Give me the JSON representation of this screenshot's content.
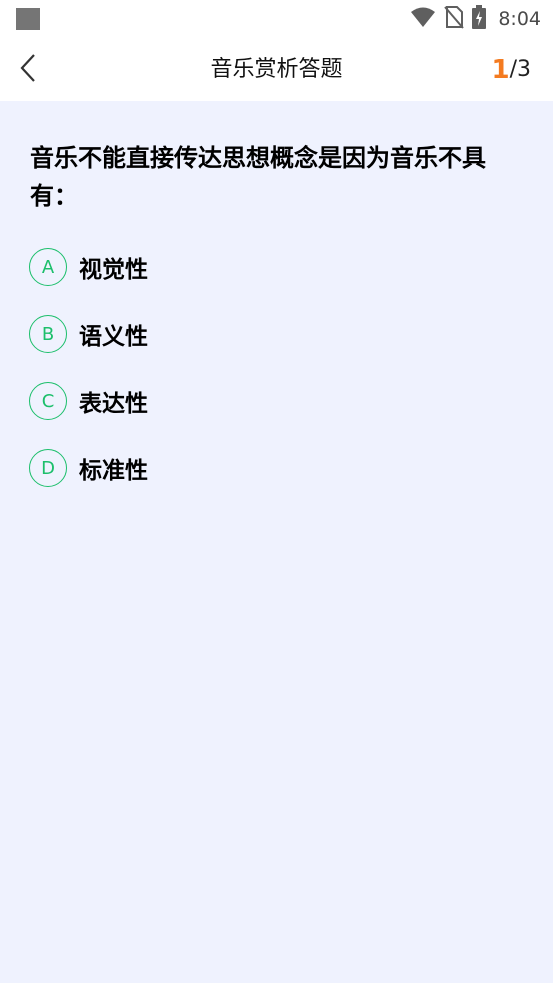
{
  "status_bar": {
    "time": "8:04",
    "icons": [
      "notification-square-icon",
      "wifi-icon",
      "no-sim-icon",
      "battery-charging-icon"
    ]
  },
  "header": {
    "title": "音乐赏析答题",
    "back_icon": "chevron-left-icon",
    "progress": {
      "current": "1",
      "total": "/3"
    }
  },
  "question": {
    "text": "音乐不能直接传达思想概念是因为音乐不具有："
  },
  "options": [
    {
      "letter": "A",
      "text": "视觉性"
    },
    {
      "letter": "B",
      "text": "语义性"
    },
    {
      "letter": "C",
      "text": "表达性"
    },
    {
      "letter": "D",
      "text": "标准性"
    }
  ],
  "colors": {
    "accent_green": "#1cbf6b",
    "progress_orange": "#f47b20",
    "background": "#eff2fe"
  }
}
